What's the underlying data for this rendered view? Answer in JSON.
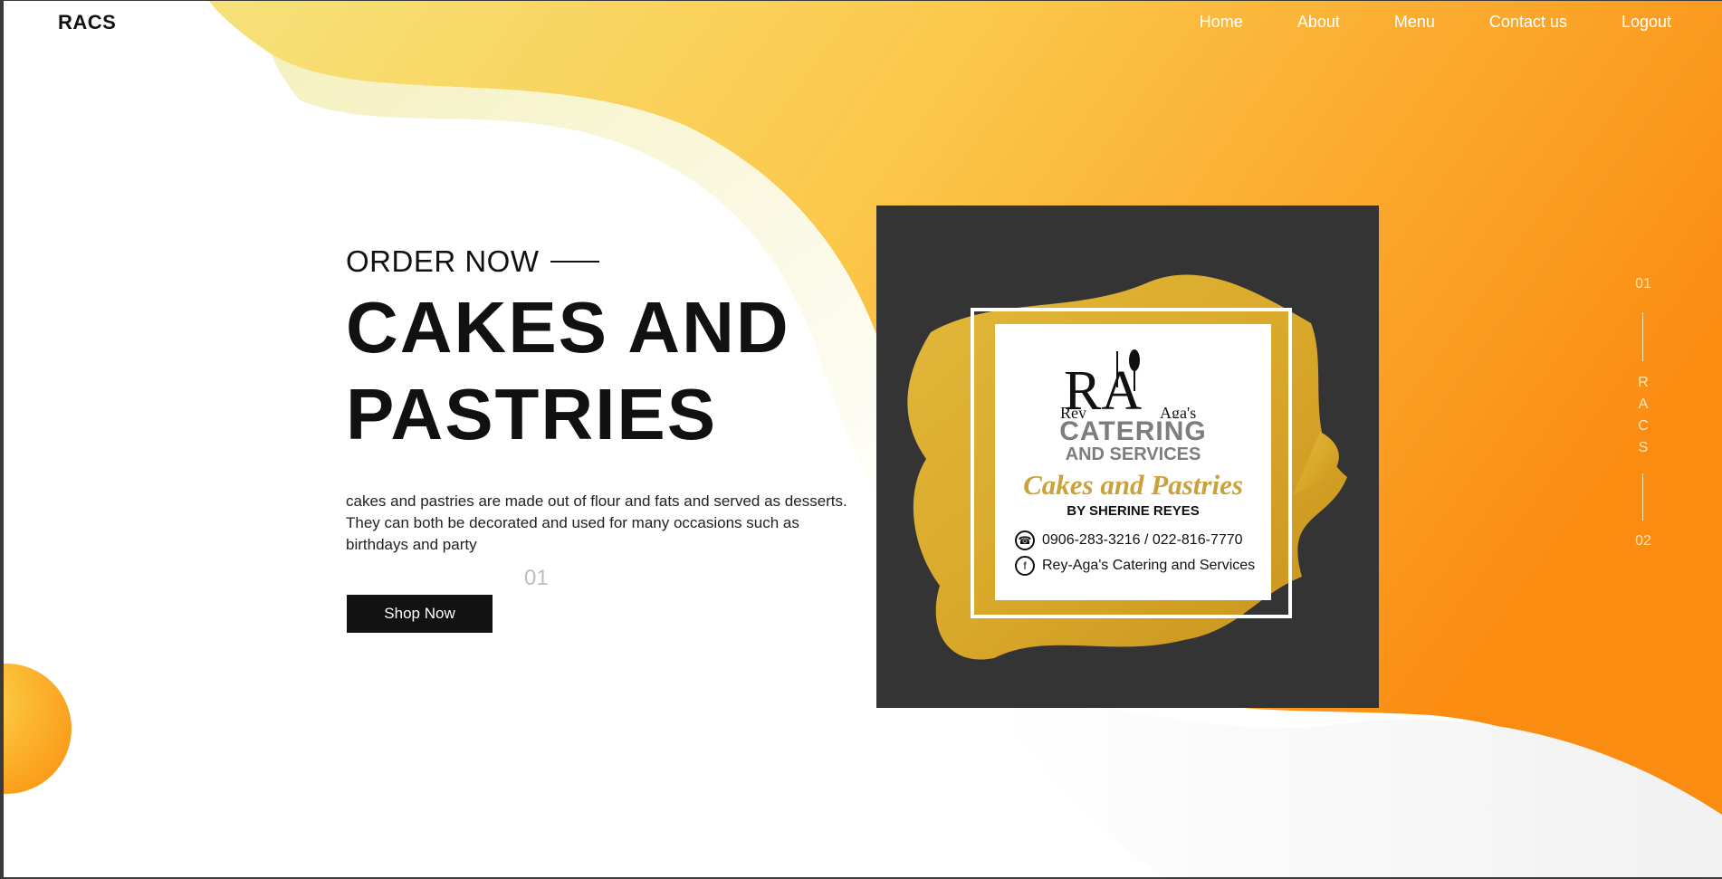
{
  "app": {
    "logo": "RACS"
  },
  "nav": {
    "items": [
      "Home",
      "About",
      "Menu",
      "Contact us",
      "Logout"
    ]
  },
  "hero": {
    "eyebrow": "ORDER NOW",
    "title_line1": "CAKES AND",
    "title_line2": "PASTRIES",
    "description": "cakes and pastries are made out of flour and fats and served as desserts. They can both be decorated and used for many occasions such as birthdays and party",
    "slide_number": "01",
    "cta_label": "Shop Now"
  },
  "feature_image": {
    "brand_letters": "RA",
    "brand_first": "Rey",
    "brand_second": "Aga's",
    "line1": "CATERING",
    "line2": "AND SERVICES",
    "script": "Cakes and Pastries",
    "byline": "BY SHERINE REYES",
    "phone": "0906-283-3216 / 022-816-7770",
    "facebook": "Rey-Aga's Catering and Services"
  },
  "side_indicator": {
    "current": "01",
    "letters": [
      "R",
      "A",
      "C",
      "S"
    ],
    "next": "02"
  },
  "colors": {
    "accent_orange": "#fb8c12",
    "accent_yellow": "#f6e27a",
    "button": "#121212",
    "image_bg": "#343434"
  }
}
